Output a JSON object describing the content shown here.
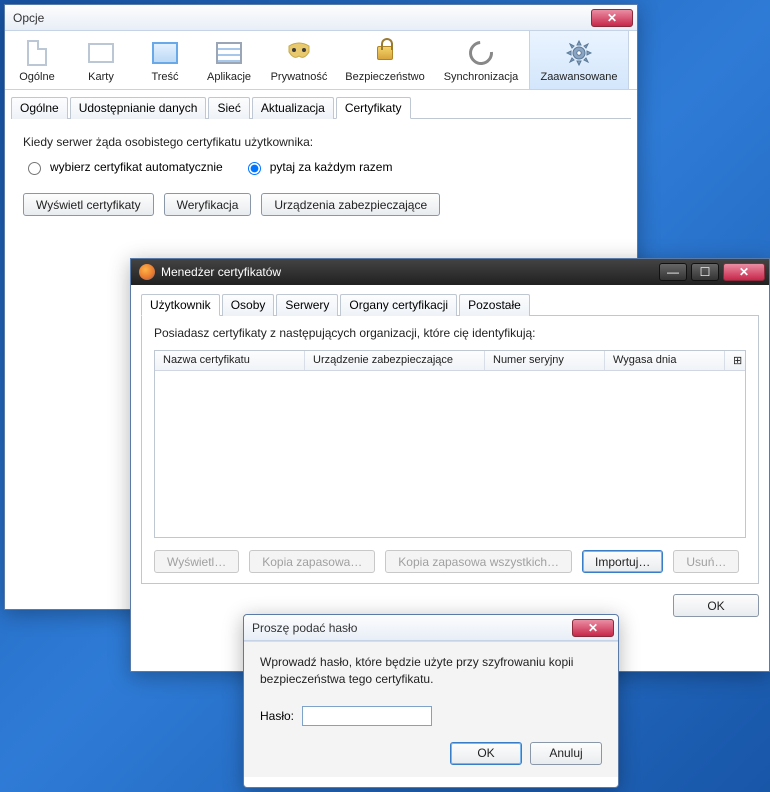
{
  "opcje": {
    "title": "Opcje",
    "toolbar": [
      {
        "label": "Ogólne"
      },
      {
        "label": "Karty"
      },
      {
        "label": "Treść"
      },
      {
        "label": "Aplikacje"
      },
      {
        "label": "Prywatność"
      },
      {
        "label": "Bezpieczeństwo"
      },
      {
        "label": "Synchronizacja"
      },
      {
        "label": "Zaawansowane"
      }
    ],
    "subtabs": [
      "Ogólne",
      "Udostępnianie danych",
      "Sieć",
      "Aktualizacja",
      "Certyfikaty"
    ],
    "active_subtab": 4,
    "cert_prompt": "Kiedy serwer żąda osobistego certyfikatu użytkownika:",
    "radio": {
      "auto": "wybierz certyfikat automatycznie",
      "ask": "pytaj za każdym razem"
    },
    "buttons": {
      "view": "Wyświetl certyfikaty",
      "verify": "Weryfikacja",
      "devices": "Urządzenia zabezpieczające"
    }
  },
  "certmgr": {
    "title": "Menedżer certyfikatów",
    "tabs": [
      "Użytkownik",
      "Osoby",
      "Serwery",
      "Organy certyfikacji",
      "Pozostałe"
    ],
    "active_tab": 0,
    "description": "Posiadasz certyfikaty z następujących organizacji, które cię identyfikują:",
    "columns": {
      "name": "Nazwa certyfikatu",
      "device": "Urządzenie zabezpieczające",
      "serial": "Numer seryjny",
      "expires": "Wygasa dnia"
    },
    "col_menu_glyph": "⊞",
    "buttons": {
      "view": "Wyświetl…",
      "backup": "Kopia zapasowa…",
      "backup_all": "Kopia zapasowa wszystkich…",
      "import": "Importuj…",
      "delete": "Usuń…",
      "ok": "OK"
    }
  },
  "pwdlg": {
    "title": "Proszę podać hasło",
    "text": "Wprowadź hasło, które będzie użyte przy szyfrowaniu kopii bezpieczeństwa tego certyfikatu.",
    "label": "Hasło:",
    "ok": "OK",
    "cancel": "Anuluj"
  },
  "glyphs": {
    "close": "✕",
    "min": "—",
    "max": "☐"
  }
}
